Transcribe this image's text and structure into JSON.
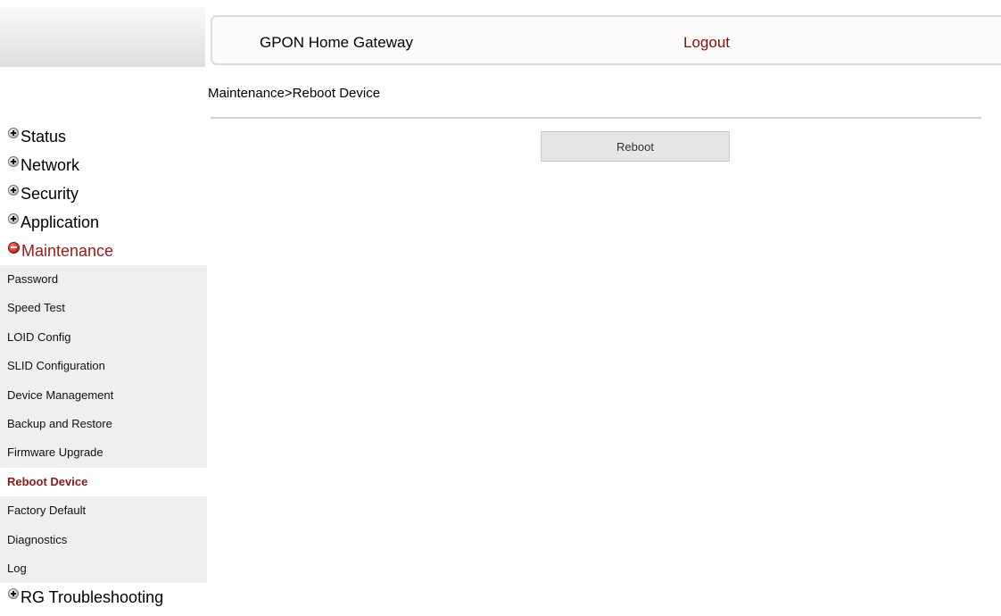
{
  "header": {
    "title": "GPON Home Gateway",
    "logout_label": "Logout"
  },
  "breadcrumb": "Maintenance>Reboot Device",
  "main": {
    "reboot_button_label": "Reboot"
  },
  "sidebar": {
    "top_items": [
      {
        "label": "Status",
        "icon": "plus-circle-icon"
      },
      {
        "label": "Network",
        "icon": "plus-circle-icon"
      },
      {
        "label": "Security",
        "icon": "plus-circle-icon"
      },
      {
        "label": "Application",
        "icon": "plus-circle-icon"
      },
      {
        "label": "Maintenance",
        "icon": "minus-circle-icon",
        "expanded": true
      }
    ],
    "maintenance_items": [
      {
        "label": "Password"
      },
      {
        "label": "Speed Test"
      },
      {
        "label": "LOID Config"
      },
      {
        "label": "SLID Configuration"
      },
      {
        "label": "Device Management"
      },
      {
        "label": "Backup and Restore"
      },
      {
        "label": "Firmware Upgrade"
      },
      {
        "label": "Reboot Device",
        "active": true
      },
      {
        "label": "Factory Default"
      },
      {
        "label": "Diagnostics"
      },
      {
        "label": "Log"
      }
    ],
    "after_items": [
      {
        "label": "RG Troubleshooting",
        "icon": "plus-circle-icon"
      }
    ]
  },
  "colors": {
    "accent_red": "#8b0d0d",
    "active_item": "#8b1a1a",
    "submenu_bg": "#efefef"
  }
}
